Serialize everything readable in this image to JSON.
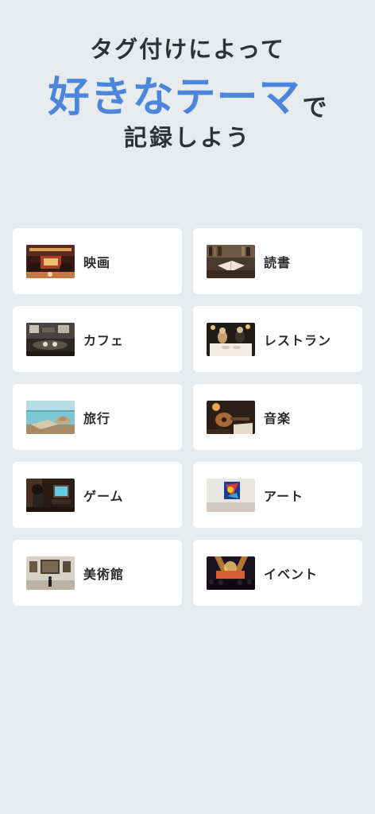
{
  "hero": {
    "line1": "タグ付けによって",
    "accent": "好きなテーマ",
    "particle": "で",
    "line3": "記録しよう"
  },
  "themes": [
    {
      "label": "映画",
      "icon": "cinema-photo-icon"
    },
    {
      "label": "読書",
      "icon": "reading-photo-icon"
    },
    {
      "label": "カフェ",
      "icon": "cafe-photo-icon"
    },
    {
      "label": "レストラン",
      "icon": "restaurant-photo-icon"
    },
    {
      "label": "旅行",
      "icon": "travel-photo-icon"
    },
    {
      "label": "音楽",
      "icon": "music-photo-icon"
    },
    {
      "label": "ゲーム",
      "icon": "game-photo-icon"
    },
    {
      "label": "アート",
      "icon": "art-photo-icon"
    },
    {
      "label": "美術館",
      "icon": "museum-photo-icon"
    },
    {
      "label": "イベント",
      "icon": "event-photo-icon"
    }
  ],
  "colors": {
    "background": "#e7ebee",
    "accent": "#4b86dc",
    "text": "#2f3133",
    "card": "#ffffff"
  }
}
